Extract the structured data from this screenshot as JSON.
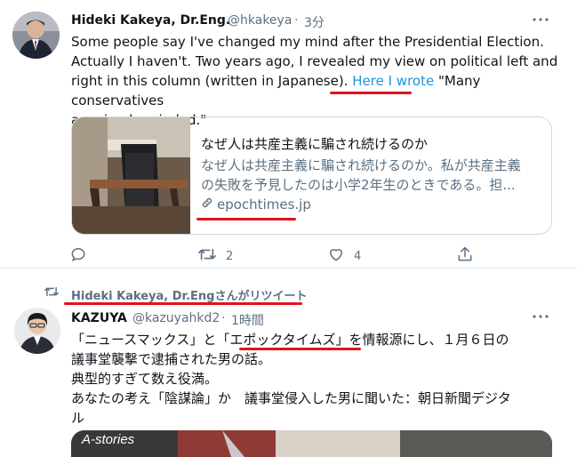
{
  "tweet1": {
    "author_name": "Hideki Kakeya, Dr.Eng.",
    "handle": "@hkakeya",
    "separator": "·",
    "time": "3分",
    "text_line1": "Some people say I've changed my mind after the Presidential Election.",
    "text_line2": "Actually I haven't.  Two years ago, I revealed my view on political left and",
    "text_line3": "right in this column (written in Japanese).",
    "text_link": "Here I wrote",
    "text_line3_tail": " \"Many conservatives",
    "text_line4": "are simple-minded.\"",
    "card": {
      "title": "なぜ人は共産主義に騙され続けるのか",
      "desc_line1": "なぜ人は共産主義に騙され続けるのか。私が共産主義",
      "desc_line2": "の失敗を予見したのは小学2年生のときである。担...",
      "domain": "epochtimes.jp"
    },
    "actions": {
      "reply_count": "",
      "retweet_count": "2",
      "like_count": "4"
    }
  },
  "retweet_banner": {
    "label": "Hideki Kakeya, Dr.Engさんがリツイート"
  },
  "tweet2": {
    "author_name": "KAZUYA",
    "handle": "@kazuyahkd2",
    "separator": "·",
    "time": "1時間",
    "line1_a": "「ニュースマックス」と",
    "line1_b": "「エポックタイムズ」",
    "line1_c": "を情報源にし、１月６日の",
    "line2": "議事堂襲撃で逮捕された男の話。",
    "line3": "典型的すぎて数え役満。",
    "line4": "あなたの考え「陰謀論」か　議事堂侵入した男に聞いた：朝日新聞デジタ",
    "line5": "ル",
    "media_label": "A-stories"
  },
  "colors": {
    "accent": "#1b95e0",
    "muted": "#5b7083",
    "annotation_red": "#e0141d",
    "border": "#cfd9de"
  }
}
